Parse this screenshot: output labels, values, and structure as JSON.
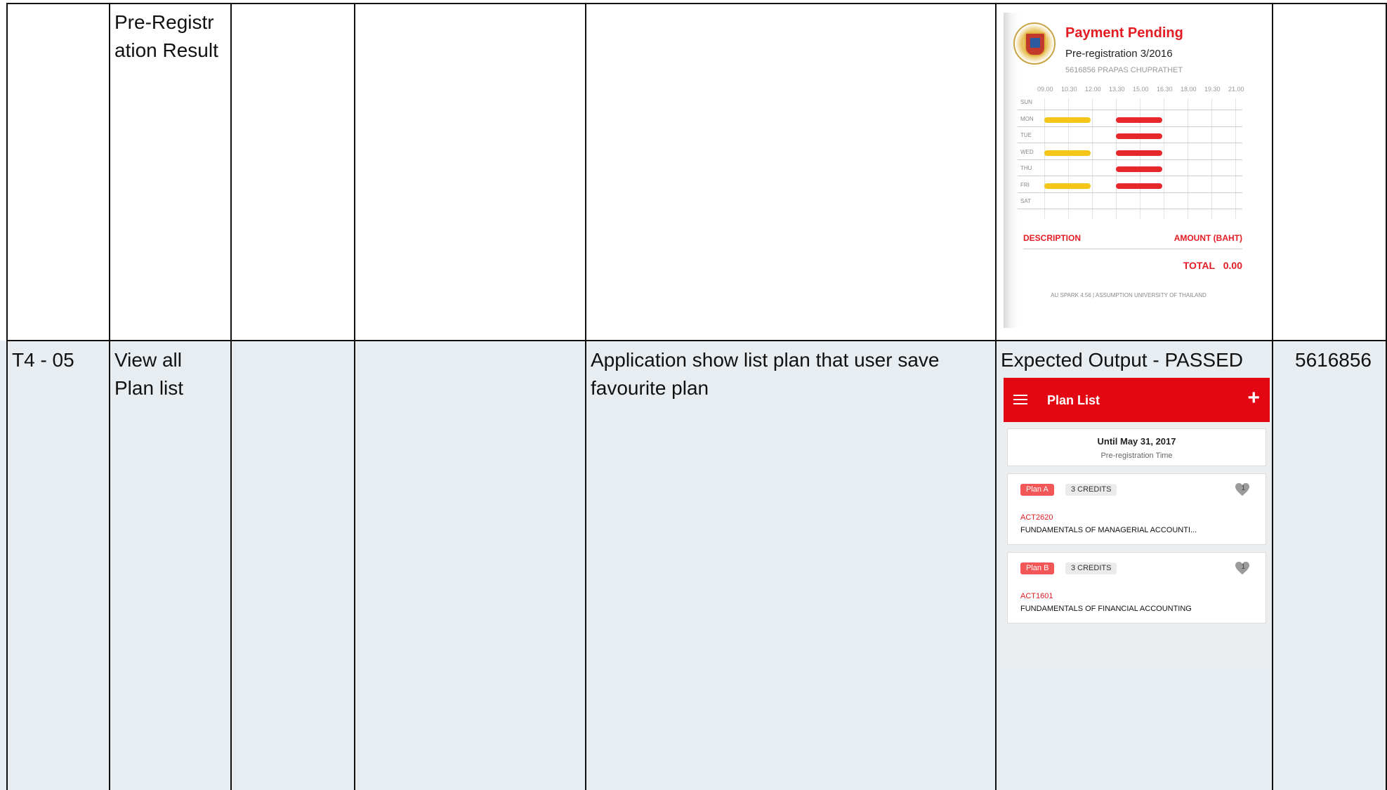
{
  "row1": {
    "feature": "Pre-Registr\nation Result"
  },
  "row2": {
    "id": "T4 - 05",
    "feature": "View all\nPlan list",
    "expected": "Application show list plan that user save\nfavourite plan",
    "result_label": "Expected Output - PASSED",
    "tester": "5616856"
  },
  "payment_screen": {
    "title": "Payment Pending",
    "subtitle": "Pre-registration 3/2016",
    "student": "5616856 PRAPAS CHUPRATHET",
    "times": [
      "09.00",
      "10.30",
      "12.00",
      "13.30",
      "15.00",
      "16.30",
      "18.00",
      "19.30",
      "21.00"
    ],
    "days": [
      "SUN",
      "MON",
      "TUE",
      "WED",
      "THU",
      "FRI",
      "SAT"
    ],
    "schedule": [
      {
        "day": "MON",
        "start": "09.00",
        "end": "12.00",
        "color": "#f5c518"
      },
      {
        "day": "MON",
        "start": "13.30",
        "end": "16.30",
        "color": "#e8272c"
      },
      {
        "day": "TUE",
        "start": "13.30",
        "end": "16.30",
        "color": "#e8272c"
      },
      {
        "day": "WED",
        "start": "09.00",
        "end": "12.00",
        "color": "#f5c518"
      },
      {
        "day": "WED",
        "start": "13.30",
        "end": "16.30",
        "color": "#e8272c"
      },
      {
        "day": "THU",
        "start": "13.30",
        "end": "16.30",
        "color": "#e8272c"
      },
      {
        "day": "FRI",
        "start": "09.00",
        "end": "12.00",
        "color": "#f5c518"
      },
      {
        "day": "FRI",
        "start": "13.30",
        "end": "16.30",
        "color": "#e8272c"
      }
    ],
    "description_label": "DESCRIPTION",
    "amount_label": "AMOUNT (BAHT)",
    "total_label": "TOTAL",
    "total_value": "0.00",
    "footer": "AU SPARK 4.56 | ASSUMPTION UNIVERSITY OF THAILAND"
  },
  "plan_screen": {
    "title": "Plan List",
    "add_icon": "plus-icon",
    "menu_icon": "hamburger-menu-icon",
    "deadline": "Until May 31, 2017",
    "deadline_caption": "Pre-registration Time",
    "plans": [
      {
        "tag": "Plan A",
        "credits": "3 CREDITS",
        "count": "1",
        "code": "ACT2620",
        "course": "FUNDAMENTALS OF MANAGERIAL ACCOUNTI..."
      },
      {
        "tag": "Plan B",
        "credits": "3 CREDITS",
        "count": "1",
        "code": "ACT1601",
        "course": "FUNDAMENTALS OF FINANCIAL ACCOUNTING"
      }
    ],
    "accent": "#e30613"
  }
}
